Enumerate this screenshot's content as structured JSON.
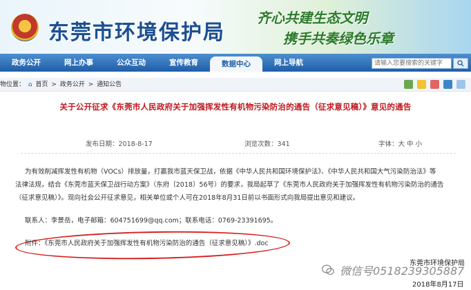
{
  "header": {
    "site_title": "东莞市环境保护局",
    "slogan_line1": "齐心共建生态文明",
    "slogan_line2": "携手共奏绿色乐章"
  },
  "nav": {
    "items": [
      "政务公开",
      "网上办事",
      "公众互动",
      "宣传教育",
      "数据中心",
      "网上导航"
    ],
    "active_index": 4
  },
  "search": {
    "placeholder": "请输入您要搜索的关键字"
  },
  "breadcrumb": {
    "prefix": "物位置：",
    "items": [
      "首页",
      "政务公开",
      "通知公告"
    ],
    "separator": ">"
  },
  "article": {
    "title": "关于公开征求《东莞市人民政府关于加强挥发性有机物污染防治的通告（征求意见稿）》意见的通告",
    "publish_date": "发布日期：2018-8-17",
    "views": "浏览次数：341",
    "font_label": "字体：大 中 小",
    "paragraph1_line1": "为有效削减挥发性有机物（VOCs）排放量，打赢我市蓝天保卫战，依据《中华人民共和国环境保护法》、《中华人民共和国大气污染防治法》等",
    "paragraph1_line2": "法律法规，结合《东莞市蓝天保卫战行动方案》（东府〔2018〕56号）的要求，我局起草了《东莞市人民政府关于加强挥发性有机物污染防治的通告",
    "paragraph1_line3": "（征求意见稿）》。现向社会公开征求意见，相关单位或个人可在2018年8月31日前以书面形式向我局提出意见和建议。",
    "contact": "联系人：李景岳，电子邮箱：604751699@qq.com；联系电话：0769-23391695。",
    "attachment": "附件：《东莞市人民政府关于加强挥发性有机物污染防治的通告（征求意见稿）》.doc"
  },
  "watermark": {
    "org": "东莞市环境保护局",
    "wechat": "微信号0518239305887",
    "date": "2018年8月17日"
  },
  "colors": {
    "nav_blue": "#1f5ea8",
    "title_red": "#c0171c",
    "annotation_red": "#d81e1e"
  }
}
